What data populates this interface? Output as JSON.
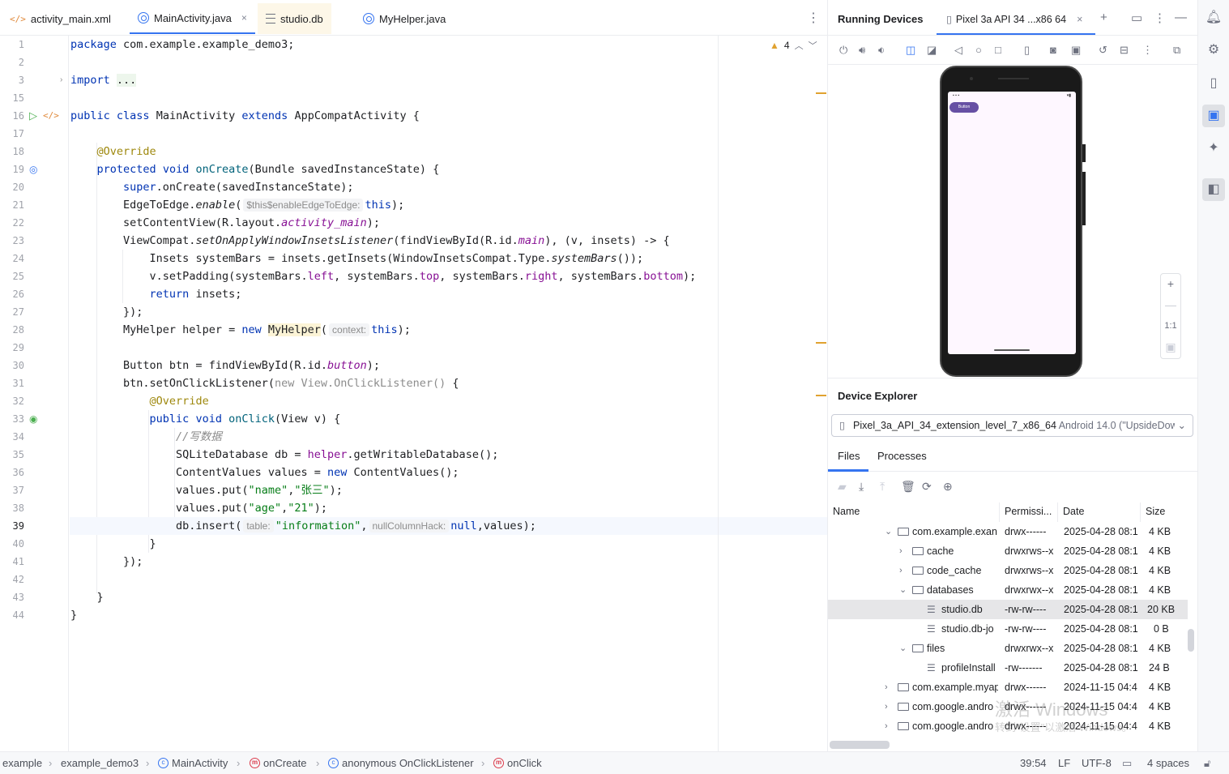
{
  "editor": {
    "tabs": [
      {
        "label": "activity_main.xml",
        "icon": "xml-file-icon"
      },
      {
        "label": "MainActivity.java",
        "icon": "java-class-icon",
        "active": true
      },
      {
        "label": "studio.db",
        "icon": "database-file-icon"
      },
      {
        "label": "MyHelper.java",
        "icon": "java-class-icon"
      }
    ],
    "close_glyph": "×",
    "more_glyph": "⋮",
    "warnings_count": "4",
    "line_numbers": [
      "1",
      "2",
      "3",
      "15",
      "16",
      "17",
      "18",
      "19",
      "20",
      "21",
      "22",
      "23",
      "24",
      "25",
      "26",
      "27",
      "28",
      "29",
      "30",
      "31",
      "32",
      "33",
      "34",
      "35",
      "36",
      "37",
      "38",
      "39",
      "40",
      "41",
      "42",
      "43",
      "44"
    ],
    "current_line": "39",
    "code": {
      "l1_kw": "package",
      "l1_rest": " com.example.example_demo3;",
      "l3_kw": "import",
      "l3_fold": "...",
      "l16_kw1": "public",
      "l16_kw2": "class",
      "l16_name": "MainActivity",
      "l16_kw3": "extends",
      "l16_rest": "AppCompatActivity {",
      "l18_an": "@Override",
      "l19_kw1": "protected",
      "l19_kw2": "void",
      "l19_fn": "onCreate",
      "l19_rest": "(Bundle savedInstanceState) {",
      "l20_kw": "super",
      "l20_rest": ".onCreate(savedInstanceState);",
      "l21_a": "EdgeToEdge.",
      "l21_it": "enable",
      "l21_b": "(",
      "l21_hint": "$this$enableEdgeToEdge:",
      "l21_kw": "this",
      "l21_c": ");",
      "l22_a": "setContentView(R.layout.",
      "l22_fld": "activity_main",
      "l22_b": ");",
      "l23_a": "ViewCompat.",
      "l23_it": "setOnApplyWindowInsetsListener",
      "l23_b": "(findViewById(R.id.",
      "l23_fld": "main",
      "l23_c": "), (v, insets) -> {",
      "l24_a": "Insets systemBars = insets.getInsets(WindowInsetsCompat.Type.",
      "l24_it": "systemBars",
      "l24_b": "());",
      "l25_a": "v.setPadding(systemBars.",
      "l25_f1": "left",
      "l25_b": ", systemBars.",
      "l25_f2": "top",
      "l25_c": ", systemBars.",
      "l25_f3": "right",
      "l25_d": ", systemBars.",
      "l25_f4": "bottom",
      "l25_e": ");",
      "l26_kw": "return",
      "l26_rest": " insets;",
      "l27": "});",
      "l28_a": "MyHelper helper = ",
      "l28_kw": "new",
      "l28_cls": "MyHelper",
      "l28_b": "(",
      "l28_hint": "context:",
      "l28_kw2": "this",
      "l28_c": ");",
      "l30_a": "Button btn = findViewById(R.id.",
      "l30_fld": "button",
      "l30_b": ");",
      "l31_a": "btn.setOnClickListener(",
      "l31_grey": "new View.OnClickListener()",
      "l31_b": " {",
      "l32_an": "@Override",
      "l33_kw1": "public",
      "l33_kw2": "void",
      "l33_fn": "onClick",
      "l33_rest": "(View v) {",
      "l34_cm": "//写数据",
      "l35_a": "SQLiteDatabase db = ",
      "l35_fld": "helper",
      "l35_b": ".getWritableDatabase();",
      "l36_a": "ContentValues values = ",
      "l36_kw": "new",
      "l36_b": " ContentValues();",
      "l37_a": "values.put(",
      "l37_s1": "\"name\"",
      "l37_b": ",",
      "l37_s2": "\"张三\"",
      "l37_c": ");",
      "l38_a": "values.put(",
      "l38_s1": "\"age\"",
      "l38_b": ",",
      "l38_s2": "\"21\"",
      "l38_c": ");",
      "l39_a": "db.insert(",
      "l39_hint1": "table:",
      "l39_s1": "\"information\"",
      "l39_b": ",",
      "l39_hint2": "nullColumnHack:",
      "l39_kw": "null",
      "l39_c": ",values);",
      "l40": "}",
      "l41": "});",
      "l43": "}",
      "l44": "}"
    }
  },
  "running_devices": {
    "title": "Running Devices",
    "device_tab": "Pixel 3a API 34 ...x86 64",
    "phone_button_label": "Button",
    "zoom_actual_label": "1:1"
  },
  "device_explorer": {
    "title": "Device Explorer",
    "device_name": "Pixel_3a_API_34_extension_level_7_x86_64",
    "device_os": "Android 14.0 (\"UpsideDow",
    "tabs": [
      "Files",
      "Processes"
    ],
    "columns": [
      "Name",
      "Permissi...",
      "Date",
      "Size"
    ],
    "rows": [
      {
        "name": "com.example.exan",
        "perm": "drwx------",
        "date": "2025-04-28 08:1",
        "size": "4 KB",
        "type": "folder",
        "state": "open"
      },
      {
        "name": "cache",
        "perm": "drwxrws--x",
        "date": "2025-04-28 08:1",
        "size": "4 KB",
        "type": "folder",
        "state": "closed"
      },
      {
        "name": "code_cache",
        "perm": "drwxrws--x",
        "date": "2025-04-28 08:1:",
        "size": "4 KB",
        "type": "folder",
        "state": "closed"
      },
      {
        "name": "databases",
        "perm": "drwxrwx--x",
        "date": "2025-04-28 08:1",
        "size": "4 KB",
        "type": "folder",
        "state": "open"
      },
      {
        "name": "studio.db",
        "perm": "-rw-rw----",
        "date": "2025-04-28 08:1",
        "size": "20 KB",
        "type": "file",
        "selected": true
      },
      {
        "name": "studio.db-jo",
        "perm": "-rw-rw----",
        "date": "2025-04-28 08:1",
        "size": "0 B",
        "type": "file"
      },
      {
        "name": "files",
        "perm": "drwxrwx--x",
        "date": "2025-04-28 08:1",
        "size": "4 KB",
        "type": "folder",
        "state": "open"
      },
      {
        "name": "profileInstall",
        "perm": "-rw-------",
        "date": "2025-04-28 08:1",
        "size": "24 B",
        "type": "file"
      },
      {
        "name": "com.example.myap",
        "perm": "drwx------",
        "date": "2024-11-15 04:4",
        "size": "4 KB",
        "type": "folder",
        "state": "closed"
      },
      {
        "name": "com.google.andro",
        "perm": "drwx------",
        "date": "2024-11-15 04:4",
        "size": "4 KB",
        "type": "folder",
        "state": "closed"
      },
      {
        "name": "com.google.andro",
        "perm": "drwx------",
        "date": "2024-11-15 04:4",
        "size": "4 KB",
        "type": "folder",
        "state": "closed"
      }
    ],
    "watermark_line1": "激活 Windows",
    "watermark_line2": "转到\"设置\"以激活 Windows。"
  },
  "status_bar": {
    "breadcrumbs": [
      "example",
      "example_demo3",
      "MainActivity",
      "onCreate",
      "anonymous OnClickListener",
      "onClick"
    ],
    "position": "39:54",
    "line_ending": "LF",
    "encoding": "UTF-8",
    "indent": "4 spaces"
  },
  "colors": {
    "accent": "#3574f0",
    "keyword": "#0033b3",
    "string": "#067d17",
    "annotation": "#9e880d",
    "field": "#871094",
    "warning": "#e0a230",
    "method_icon": "#db3b4b"
  }
}
